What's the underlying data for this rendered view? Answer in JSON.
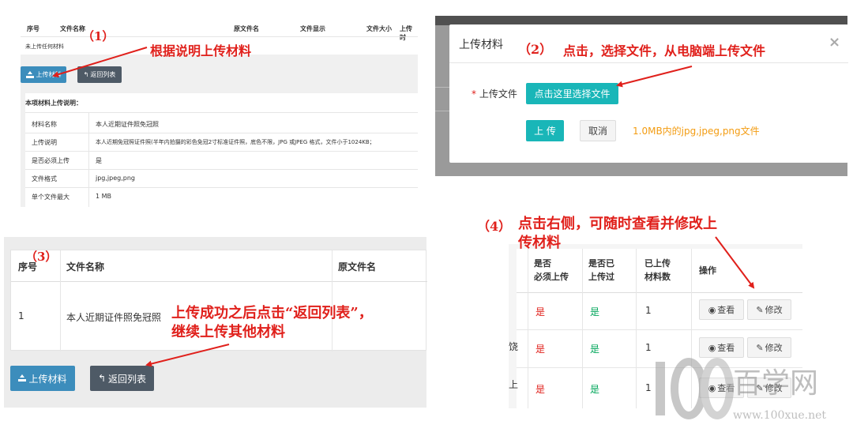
{
  "panel1": {
    "headers": [
      "序号",
      "文件名称",
      "原文件名",
      "文件显示",
      "文件大小",
      "上传时"
    ],
    "empty_text": "未上传任何材料",
    "buttons": {
      "upload": "上传材料",
      "back": "返回列表"
    },
    "section_title": "本项材料上传说明：",
    "rows": [
      {
        "label": "材料名称",
        "value": "本人近期证件照免冠照"
      },
      {
        "label": "上传说明",
        "value": "本人近期免冠照证件照(半年内拍摄的彩色免冠2寸标准证件照，底色不限，JPG 或JPEG 格式，文件小于1024KB；"
      },
      {
        "label": "是否必须上传",
        "value": "是"
      },
      {
        "label": "文件格式",
        "value": "jpg,jpeg,png"
      },
      {
        "label": "单个文件最大",
        "value": "1 MB"
      }
    ]
  },
  "panel2": {
    "modal_title": "上传材料",
    "close": "×",
    "field_label": "上传文件",
    "required_mark": "*",
    "choose_button": "点击这里选择文件",
    "upload_button": "上 传",
    "cancel_button": "取消",
    "hint": "1.0MB内的jpg,jpeg,png文件"
  },
  "panel3": {
    "headers": [
      "序号",
      "文件名称",
      "原文件名"
    ],
    "row": {
      "index": "1",
      "name": "本人近期证件照免冠照"
    },
    "buttons": {
      "upload": "上传材料",
      "back": "返回列表"
    }
  },
  "panel4": {
    "headers": [
      "是否\n必须上传",
      "是否已\n上传过",
      "已上传\n材料数",
      "操作"
    ],
    "rows": [
      {
        "frag": "",
        "required": "是",
        "uploaded": "是",
        "count": "1"
      },
      {
        "frag": "饶",
        "required": "是",
        "uploaded": "是",
        "count": "1"
      },
      {
        "frag": "上",
        "required": "是",
        "uploaded": "是",
        "count": "1"
      }
    ],
    "view_label": "查看",
    "edit_label": "修改"
  },
  "annotations": {
    "a1_num": "（1）",
    "a1_text": "根据说明上传材料",
    "a2_num": "（2）",
    "a2_text": "点击，选择文件，从电脑端上传文件",
    "a3_num": "（3）",
    "a3_line1": "上传成功之后点击“返回列表”，",
    "a3_line2": "继续上传其他材料",
    "a4_num": "（4）",
    "a4_line1": "点击右侧，可随时查看并修改上",
    "a4_line2": "传材料"
  },
  "watermark": {
    "brand": "百学网",
    "url": "www.100xue.net"
  },
  "colors": {
    "annotation": "#e0201b",
    "primary": "#3c8dbc",
    "teal": "#19b6b8",
    "hint": "#f39c12",
    "green": "#00a65a",
    "dark": "#4e5a66"
  }
}
